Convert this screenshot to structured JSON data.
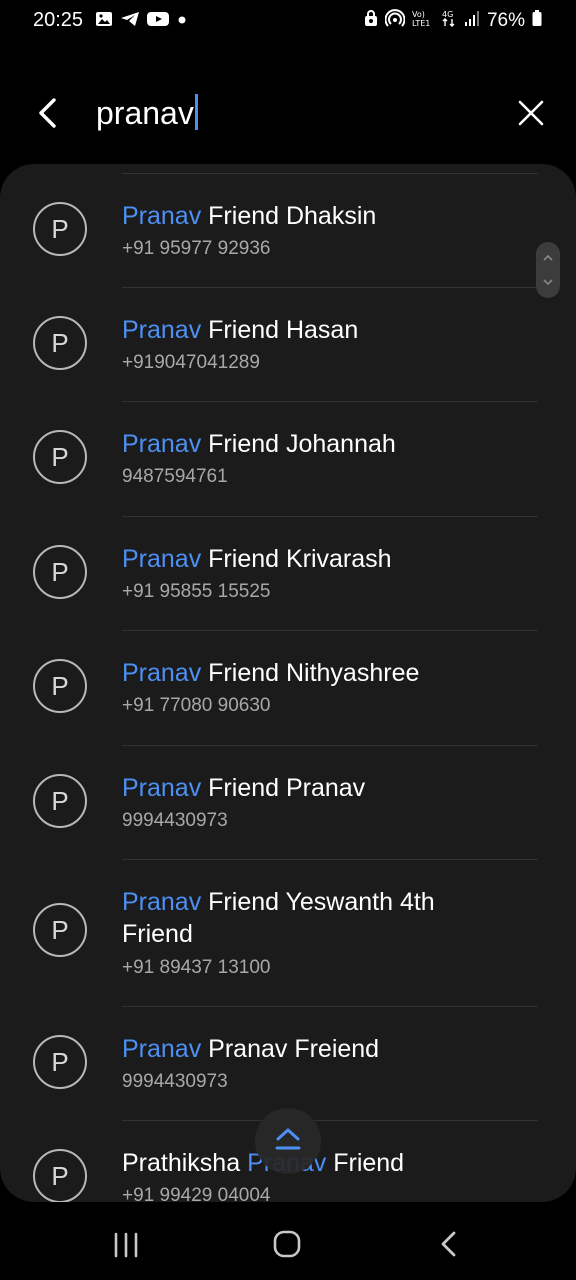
{
  "status_bar": {
    "time": "20:25",
    "battery": "76%",
    "notification_icons": [
      "image-icon",
      "telegram-icon",
      "youtube-icon",
      "dot-icon"
    ],
    "system_icons": [
      "vpn-key-icon",
      "hotspot-icon",
      "volte-icon",
      "4g-icon",
      "signal-icon",
      "battery-icon"
    ],
    "volte_label": "Vo) LTE1",
    "network_label": "4G"
  },
  "search": {
    "query": "pranav"
  },
  "results": [
    {
      "match": "Pranav",
      "rest": " Friend Dhaksin",
      "phone": "+91 95977 92936"
    },
    {
      "match": "Pranav",
      "rest": " Friend Hasan",
      "phone": "+919047041289"
    },
    {
      "match": "Pranav",
      "rest": " Friend Johannah",
      "phone": "9487594761"
    },
    {
      "match": "Pranav",
      "rest": " Friend Krivarash",
      "phone": "+91 95855 15525"
    },
    {
      "match": "Pranav",
      "rest": " Friend Nithyashree",
      "phone": "+91 77080 90630"
    },
    {
      "match": "Pranav",
      "rest": " Friend Pranav",
      "phone": "9994430973"
    },
    {
      "match": "Pranav",
      "rest": " Friend Yeswanth 4th Friend",
      "phone": "+91 89437 13100"
    },
    {
      "match": "Pranav",
      "rest": " Pranav Freiend",
      "phone": "9994430973"
    },
    {
      "prefix": "Prathiksha ",
      "match": "Pranav",
      "rest": " Friend",
      "phone": "+91 99429 04004"
    }
  ],
  "avatar_letter": "P",
  "colors": {
    "highlight": "#4d8ff3",
    "panel": "#1b1b1b",
    "background": "#000000"
  }
}
